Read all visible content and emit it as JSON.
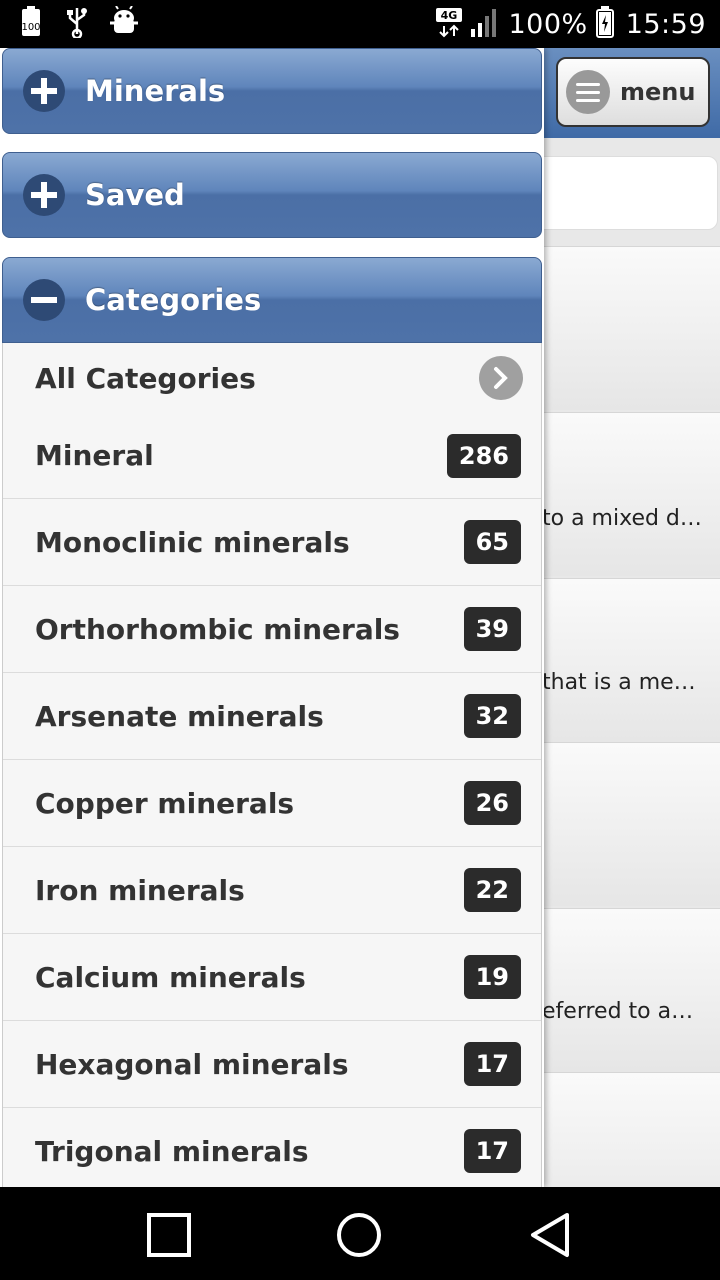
{
  "status_bar": {
    "battery_label": "100",
    "network_label": "4G",
    "battery_percent": "100%",
    "time": "15:59"
  },
  "background": {
    "menu_label": "menu",
    "rows": [
      {
        "snippet": ""
      },
      {
        "snippet": "to a mixed d…"
      },
      {
        "snippet": "that is a me…"
      },
      {
        "snippet": ""
      },
      {
        "snippet": "eferred to a…"
      }
    ]
  },
  "drawer": {
    "panels": [
      {
        "label": "Minerals",
        "state": "collapsed"
      },
      {
        "label": "Saved",
        "state": "collapsed"
      },
      {
        "label": "Categories",
        "state": "expanded"
      }
    ],
    "all_categories_label": "All Categories",
    "categories": [
      {
        "label": "Mineral",
        "count": "286"
      },
      {
        "label": "Monoclinic minerals",
        "count": "65"
      },
      {
        "label": "Orthorhombic minerals",
        "count": "39"
      },
      {
        "label": "Arsenate minerals",
        "count": "32"
      },
      {
        "label": "Copper minerals",
        "count": "26"
      },
      {
        "label": "Iron minerals",
        "count": "22"
      },
      {
        "label": "Calcium minerals",
        "count": "19"
      },
      {
        "label": "Hexagonal minerals",
        "count": "17"
      },
      {
        "label": "Trigonal minerals",
        "count": "17"
      }
    ]
  },
  "icons": {
    "status_left": [
      "battery-100-icon",
      "usb-icon",
      "android-debug-icon"
    ],
    "status_right": [
      "network-4g-icon",
      "signal-icon",
      "battery-charging-icon"
    ],
    "nav": [
      "recent-apps-icon",
      "home-icon",
      "back-icon"
    ]
  },
  "colors": {
    "header_blue": "#4b6fa6",
    "badge": "#2b2b2b"
  }
}
